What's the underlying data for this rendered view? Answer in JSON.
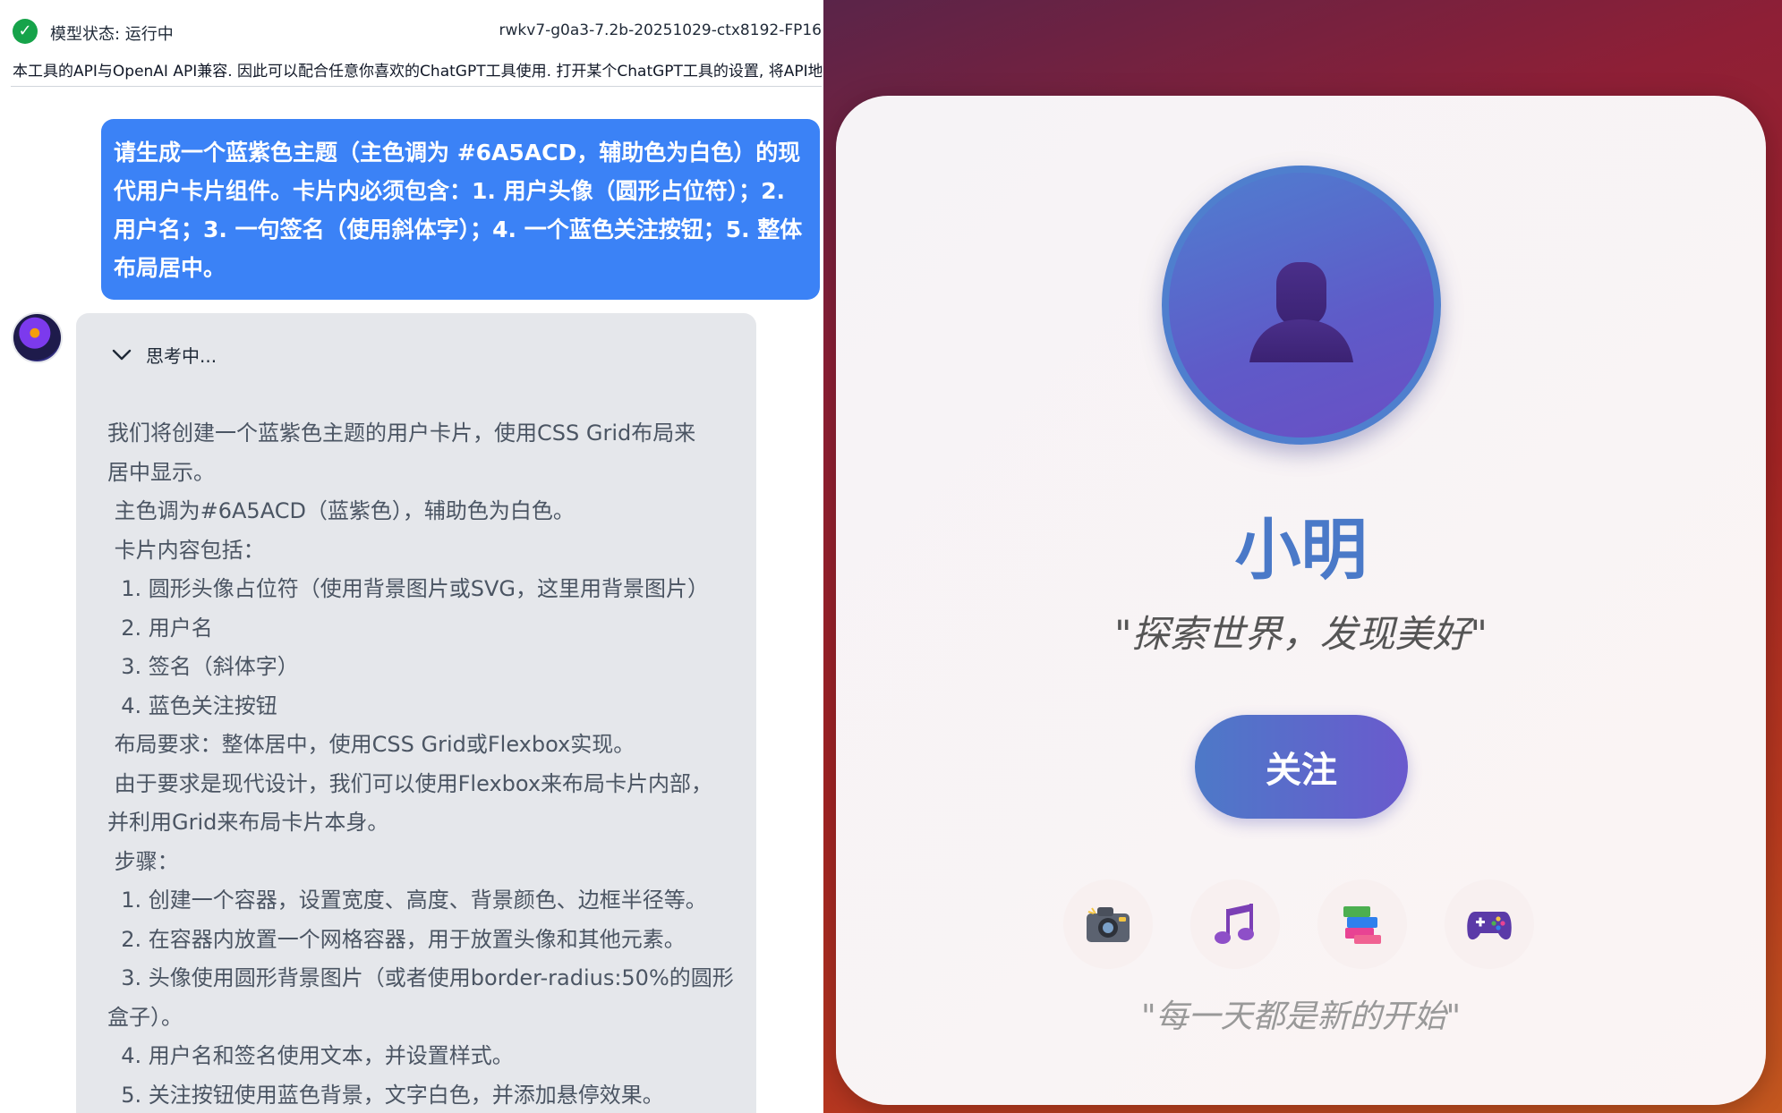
{
  "status": {
    "label": "模型状态: 运行中",
    "model": "rwkv7-g0a3-7.2b-20251029-ctx8192-FP16",
    "info": "本工具的API与OpenAI API兼容. 因此可以配合任意你喜欢的ChatGPT工具使用. 打开某个ChatGPT工具的设置, 将API地址设置为本工具的地址即可"
  },
  "chat": {
    "user_message": "请生成一个蓝紫色主题（主色调为 #6A5ACD，辅助色为白色）的现代用户卡片组件。卡片内必须包含：1. 用户头像（圆形占位符）；2. 用户名；3. 一句签名（使用斜体字）；4. 一个蓝色关注按钮；5. 整体布局居中。",
    "thinking_label": "思考中...",
    "thinking_lines": [
      "我们将创建一个蓝紫色主题的用户卡片，使用CSS Grid布局来",
      "居中显示。",
      " 主色调为#6A5ACD（蓝紫色），辅助色为白色。",
      " 卡片内容包括：",
      "  1. 圆形头像占位符（使用背景图片或SVG，这里用背景图片）",
      "  2. 用户名",
      "  3. 签名（斜体字）",
      "  4. 蓝色关注按钮",
      " 布局要求：整体居中，使用CSS Grid或Flexbox实现。",
      " 由于要求是现代设计，我们可以使用Flexbox来布局卡片内部，",
      "并利用Grid来布局卡片本身。",
      " 步骤：",
      "  1. 创建一个容器，设置宽度、高度、背景颜色、边框半径等。",
      "  2. 在容器内放置一个网格容器，用于放置头像和其他元素。",
      "  3. 头像使用圆形背景图片（或者使用border-radius:50%的圆形",
      "盒子）。",
      "  4. 用户名和签名使用文本，并设置样式。",
      "  5. 关注按钮使用蓝色背景，文字白色，并添加悬停效果。"
    ]
  },
  "card": {
    "name": "小明",
    "signature": "\"探索世界，发现美好\"",
    "follow_label": "关注",
    "hobbies": [
      "📷",
      "🎵",
      "📚",
      "🎮"
    ],
    "footer": "\"每一天都是新的开始\"",
    "colors": {
      "primary": "#6A5ACD",
      "accent_blue": "#4a79c8"
    }
  },
  "icons": [
    "check-circle-icon",
    "chevron-down-icon",
    "user-silhouette-icon",
    "camera-icon",
    "music-note-icon",
    "books-icon",
    "gamepad-icon"
  ]
}
